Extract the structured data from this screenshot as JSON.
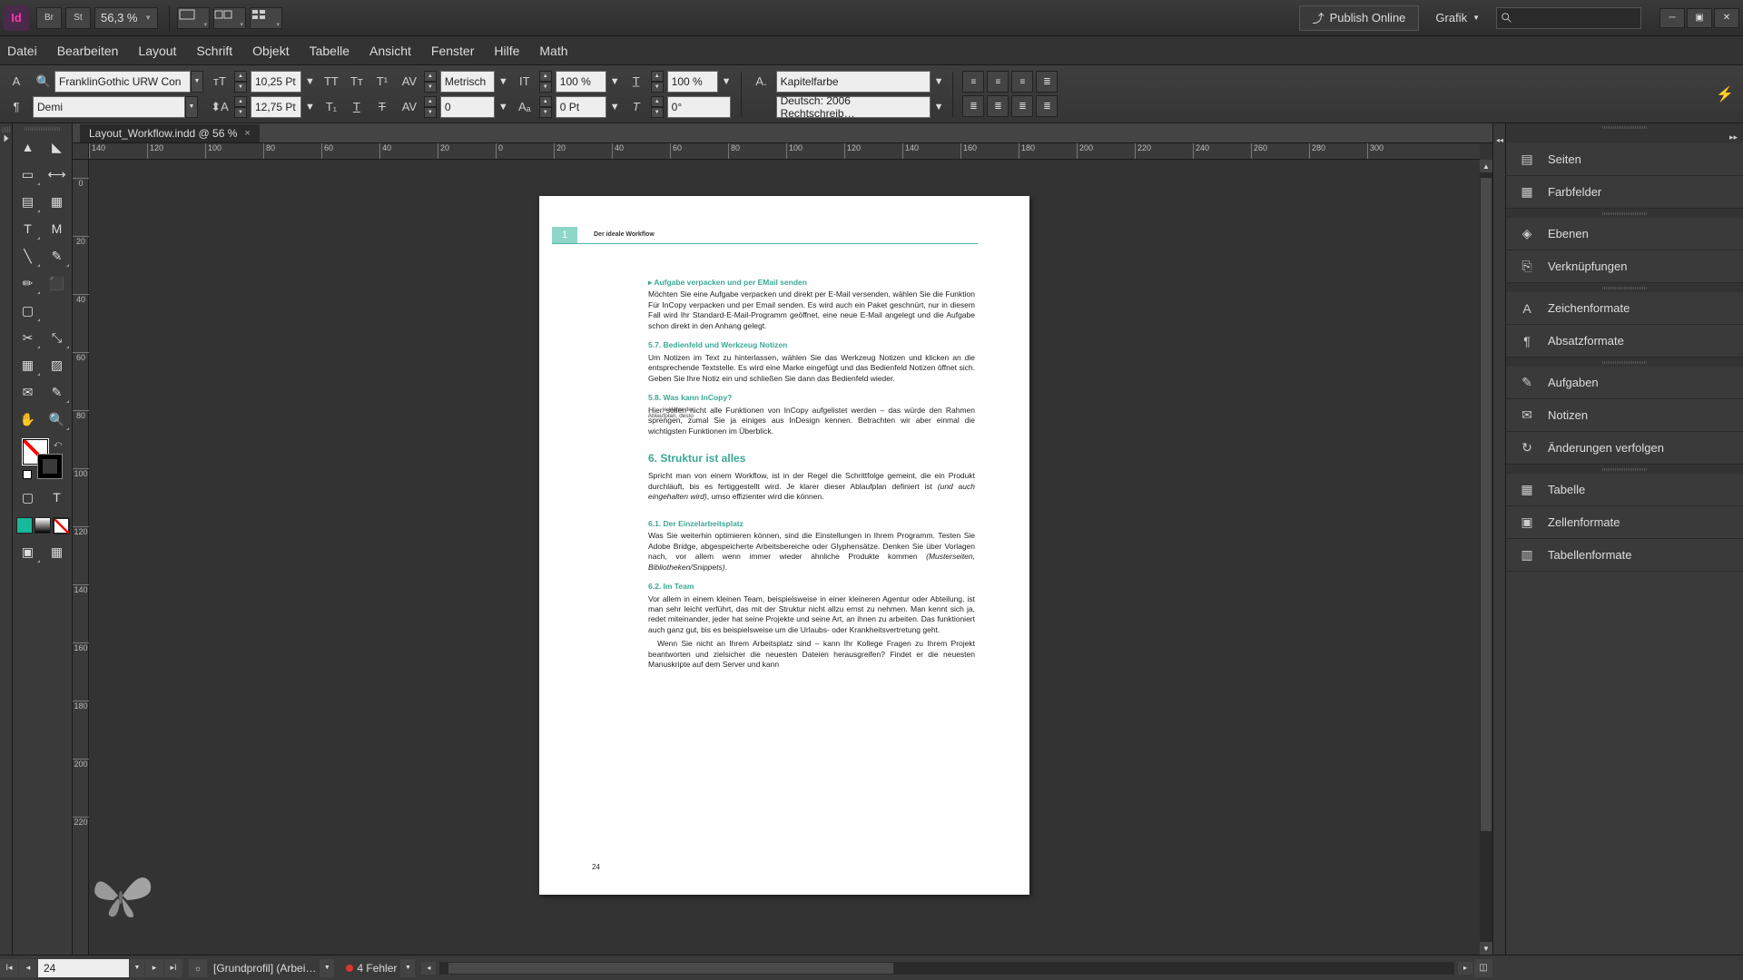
{
  "app": {
    "id_badge": "Id"
  },
  "titlebar": {
    "br_label": "Br",
    "st_label": "St",
    "zoom": "56,3 %",
    "publish": "Publish Online",
    "workspace": "Grafik"
  },
  "menu": [
    "Datei",
    "Bearbeiten",
    "Layout",
    "Schrift",
    "Objekt",
    "Tabelle",
    "Ansicht",
    "Fenster",
    "Hilfe",
    "Math"
  ],
  "control": {
    "font_family": "FranklinGothic URW Con",
    "font_style": "Demi",
    "font_size": "10,25 Pt",
    "leading": "12,75 Pt",
    "kerning_mode": "Metrisch",
    "tracking": "0",
    "vscale": "100 %",
    "hscale": "100 %",
    "baseline": "0 Pt",
    "skew": "0°",
    "char_style": "Kapitelfarbe",
    "language": "Deutsch: 2006 Rechtschreib…"
  },
  "document": {
    "tab_title": "Layout_Workflow.indd @ 56 %"
  },
  "ruler_h": [
    "140",
    "120",
    "100",
    "80",
    "60",
    "40",
    "20",
    "0",
    "20",
    "40",
    "60",
    "80",
    "100",
    "120",
    "140",
    "160",
    "180",
    "200",
    "220",
    "240",
    "260",
    "280",
    "300"
  ],
  "ruler_v": [
    "0",
    "20",
    "40",
    "60",
    "80",
    "100",
    "120",
    "140",
    "160",
    "180",
    "200",
    "220"
  ],
  "page": {
    "chapter_num": "1",
    "running_head": "Der ideale Workflow",
    "h1": "▸  Aufgabe verpacken und per EMail senden",
    "p1": "Möchten Sie eine Aufgabe verpacken und direkt per E-Mail versenden, wählen Sie die Funktion Für InCopy verpacken und per Email senden. Es wird auch ein Paket geschnürt, nur in diesem Fall wird Ihr Standard-E-Mail-Programm geöffnet, eine neue E-Mail angelegt und die Aufgabe schon direkt in den Anhang gelegt.",
    "h2": "5.7.   Bedienfeld und Werkzeug Notizen",
    "p2": "Um Notizen im Text zu hinterlassen, wählen Sie das Werkzeug Notizen und klicken an die entsprechende Textstelle. Es wird eine Marke eingefügt und das Bedienfeld Notizen öffnet sich. Geben Sie Ihre Notiz ein und schließen Sie dann das Bedienfeld wieder.",
    "margin1": "je klarer der Ablaufplan, desto",
    "h3": "5.8.   Was kann InCopy?",
    "p3": "Hier sollen nicht alle Funktionen von InCopy aufgelistet werden – das würde den Rahmen sprengen, zumal Sie ja einiges aus InDesign kennen. Betrachten wir aber einmal die wichtigsten Funktionen im Überblick.",
    "h4": "6.   Struktur ist alles",
    "p4a": "Spricht man von einem Workflow, ist in der Regel die Schrittfolge gemeint, die ein Produkt durchläuft, bis es fertiggestellt wird. Je klarer dieser Ablaufplan definiert ist ",
    "p4i": "(und auch eingehalten wird)",
    "p4b": ", umso effizienter wird die können.",
    "h5": "6.1.   Der Einzelarbeitsplatz",
    "p5a": "Was Sie weiterhin optimieren können, sind die Einstellungen in Ihrem Programm. Testen Sie Adobe Bridge, abgespeicherte Arbeitsbereiche oder Glyphensätze. Denken Sie über Vorlagen nach, vor allem wenn immer wieder ähnliche Produkte kommen ",
    "p5i": "(Musterseiten, Bibliotheken/Snippets)",
    "p5b": ".",
    "h6": "6.2.   Im Team",
    "p6": "Vor allem in einem kleinen Team, beispielsweise in einer kleineren Agentur oder Abteilung, ist man sehr leicht verführt, das mit der Struktur nicht allzu ernst zu nehmen. Man kennt sich ja, redet miteinander, jeder hat seine Projekte und seine Art, an ihnen zu arbeiten. Das funktioniert auch ganz gut, bis es beispielsweise um die Urlaubs- oder Krankheitsvertretung geht.",
    "p7": "Wenn Sie nicht an Ihrem Arbeitsplatz sind – kann Ihr Kollege Fragen zu Ihrem Projekt beantworten und zielsicher die neuesten Dateien herausgreifen? Findet er die neuesten Manuskripte auf dem Server und kann",
    "page_number": "24"
  },
  "panels": [
    {
      "icon": "pages",
      "label": "Seiten"
    },
    {
      "icon": "swatches",
      "label": "Farbfelder"
    },
    {
      "sep": true
    },
    {
      "icon": "layers",
      "label": "Ebenen"
    },
    {
      "icon": "links",
      "label": "Verknüpfungen"
    },
    {
      "sep": true
    },
    {
      "icon": "char-styles",
      "label": "Zeichenformate"
    },
    {
      "icon": "para-styles",
      "label": "Absatzformate"
    },
    {
      "sep": true
    },
    {
      "icon": "assignments",
      "label": "Aufgaben"
    },
    {
      "icon": "notes",
      "label": "Notizen"
    },
    {
      "icon": "track",
      "label": "Änderungen verfolgen"
    },
    {
      "sep": true
    },
    {
      "icon": "table",
      "label": "Tabelle"
    },
    {
      "icon": "cell-styles",
      "label": "Zellenformate"
    },
    {
      "icon": "table-styles",
      "label": "Tabellenformate"
    }
  ],
  "status": {
    "page": "24",
    "profile": "[Grundprofil] (Arbei…",
    "errors": "4 Fehler"
  }
}
